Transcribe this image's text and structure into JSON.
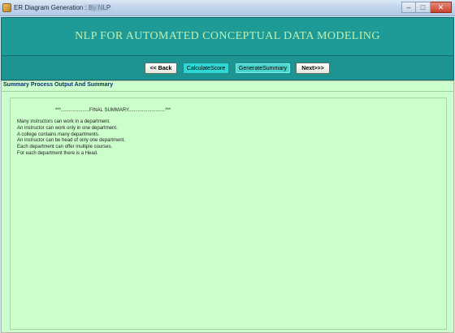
{
  "window": {
    "title": "ER Diagram Generation : By NLP",
    "app_icon": "java-cup-icon",
    "controls": {
      "minimize": "–",
      "maximize": "□",
      "close": "✕"
    }
  },
  "banner": {
    "title": "NLP FOR AUTOMATED CONCEPTUAL DATA MODELING",
    "background": "#1f9b97",
    "text_color": "#bff0b0"
  },
  "toolbar": {
    "back_label": "<< Back",
    "calculate_label": "CalculateScore",
    "generate_label": "GenerateSummary",
    "next_label": "Next>>>"
  },
  "panel": {
    "header": "Summary Process  Output And Summary",
    "background": "#ccfecb",
    "summary_heading": "***.....................FINAL SUMMARY...........................***",
    "lines": [
      "Many instructors can work in a department.",
      "An instructor can work only in one department.",
      "A college contains many departments.",
      "An instructor can be head of only one department.",
      "Each department can offer multiple courses.",
      "For each department there is a Head."
    ]
  }
}
